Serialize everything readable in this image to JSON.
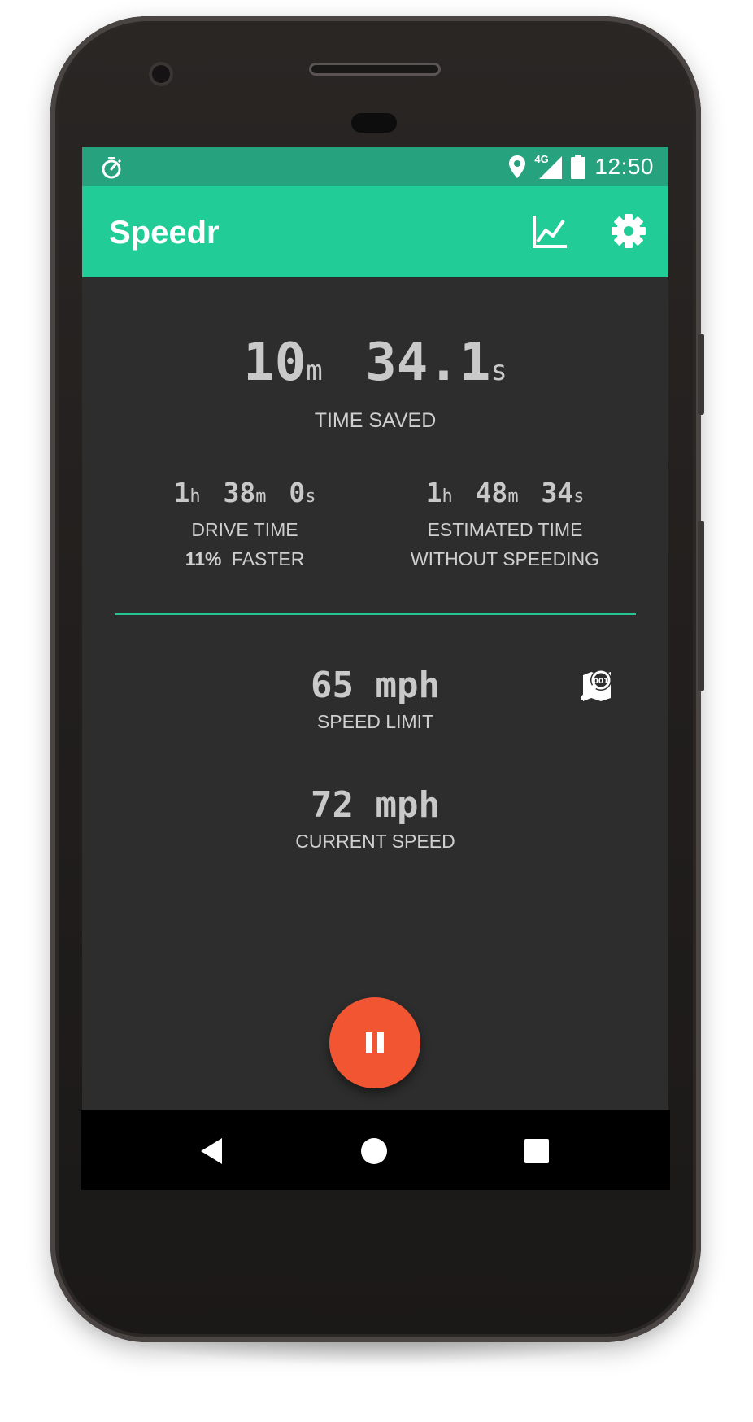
{
  "status_bar": {
    "left_icon": "stopwatch-icon",
    "network": "4G",
    "time": "12:50",
    "icons": [
      "location-icon",
      "signal-icon",
      "battery-icon"
    ]
  },
  "app_bar": {
    "title": "Speedr",
    "actions": [
      "chart-icon",
      "settings-gear-icon"
    ]
  },
  "time_saved": {
    "minutes": "10",
    "minutes_unit": "m",
    "seconds": "34.1",
    "seconds_unit": "s",
    "label": "TIME SAVED"
  },
  "drive_time": {
    "hours": "1",
    "minutes": "38",
    "seconds": "0",
    "units": {
      "h": "h",
      "m": "m",
      "s": "s"
    },
    "label": "DRIVE TIME",
    "faster_pct": "11%",
    "faster_label": "FASTER"
  },
  "estimated_time": {
    "hours": "1",
    "minutes": "48",
    "seconds": "34",
    "units": {
      "h": "h",
      "m": "m",
      "s": "s"
    },
    "label_line1": "ESTIMATED TIME",
    "label_line2": "WITHOUT SPEEDING"
  },
  "speed_limit": {
    "value": "65 mph",
    "label": "SPEED LIMIT",
    "icon": "map-search-icon"
  },
  "current_speed": {
    "value": "72 mph",
    "label": "CURRENT SPEED"
  },
  "fab": {
    "icon": "pause-icon"
  },
  "nav_bar": {
    "items": [
      "back-icon",
      "home-icon",
      "recents-icon"
    ]
  },
  "colors": {
    "status_bar": "#27a27f",
    "app_bar": "#22cc97",
    "background": "#2d2d2d",
    "accent_divider": "#27c493",
    "fab": "#f15531"
  }
}
